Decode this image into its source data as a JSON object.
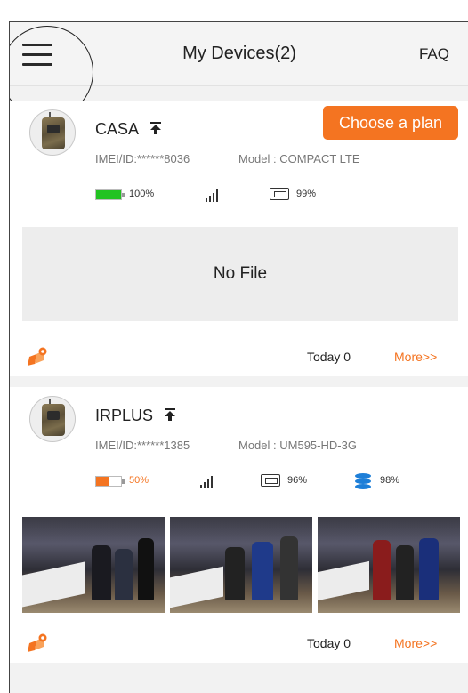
{
  "header": {
    "title": "My Devices(2)",
    "faq_label": "FAQ"
  },
  "devices": [
    {
      "name": "CASA",
      "plan_button": "Choose a plan",
      "imei": "IMEI/ID:******8036",
      "model": "Model : COMPACT LTE",
      "battery": {
        "level": 1.0,
        "text": "100%",
        "color": "#22c322"
      },
      "sd": "99%",
      "empty_text": "No File",
      "today": "Today 0",
      "more": "More>>"
    },
    {
      "name": "IRPLUS",
      "imei": "IMEI/ID:******1385",
      "model": "Model : UM595-HD-3G",
      "battery": {
        "level": 0.5,
        "text": "50%",
        "color": "#f47421"
      },
      "sd": "96%",
      "storage": "98%",
      "today": "Today 0",
      "more": "More>>"
    }
  ],
  "colors": {
    "accent": "#f47421",
    "storage_icon": "#1e7fd8"
  }
}
